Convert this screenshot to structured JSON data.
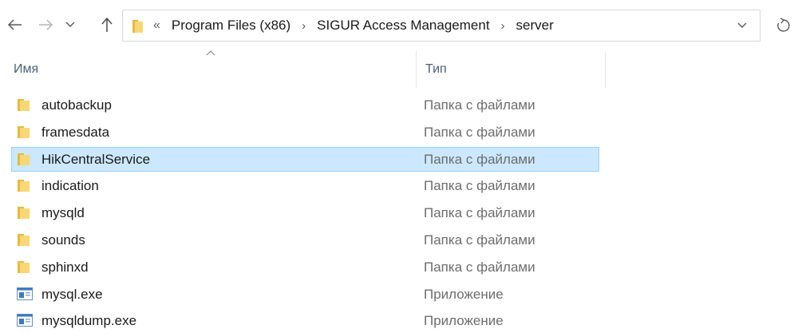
{
  "navigation": {
    "back_icon": "arrow-left-icon",
    "forward_icon": "arrow-right-icon",
    "recent_icon": "chevron-down-icon",
    "up_icon": "arrow-up-icon"
  },
  "address_bar": {
    "overflow_marker": "«",
    "crumbs": [
      "Program Files (x86)",
      "SIGUR Access Management",
      "server"
    ],
    "separator": "›",
    "dropdown_icon": "chevron-down-icon",
    "refresh_icon": "refresh-icon"
  },
  "columns": {
    "name": "Имя",
    "type": "Тип",
    "sort_indicator": "ascending"
  },
  "files": [
    {
      "name": "autobackup",
      "type": "Папка с файлами",
      "icon": "folder-icon",
      "selected": false
    },
    {
      "name": "framesdata",
      "type": "Папка с файлами",
      "icon": "folder-icon",
      "selected": false
    },
    {
      "name": "HikCentralService",
      "type": "Папка с файлами",
      "icon": "folder-icon",
      "selected": true
    },
    {
      "name": "indication",
      "type": "Папка с файлами",
      "icon": "folder-icon",
      "selected": false
    },
    {
      "name": "mysqld",
      "type": "Папка с файлами",
      "icon": "folder-icon",
      "selected": false
    },
    {
      "name": "sounds",
      "type": "Папка с файлами",
      "icon": "folder-icon",
      "selected": false
    },
    {
      "name": "sphinxd",
      "type": "Папка с файлами",
      "icon": "folder-icon",
      "selected": false
    },
    {
      "name": "mysql.exe",
      "type": "Приложение",
      "icon": "application-icon",
      "selected": false
    },
    {
      "name": "mysqldump.exe",
      "type": "Приложение",
      "icon": "application-icon",
      "selected": false
    }
  ],
  "colors": {
    "selection_bg": "#cce8ff",
    "selection_border": "#99d1ff",
    "folder": "#f8d775",
    "header_text": "#4c607a"
  }
}
